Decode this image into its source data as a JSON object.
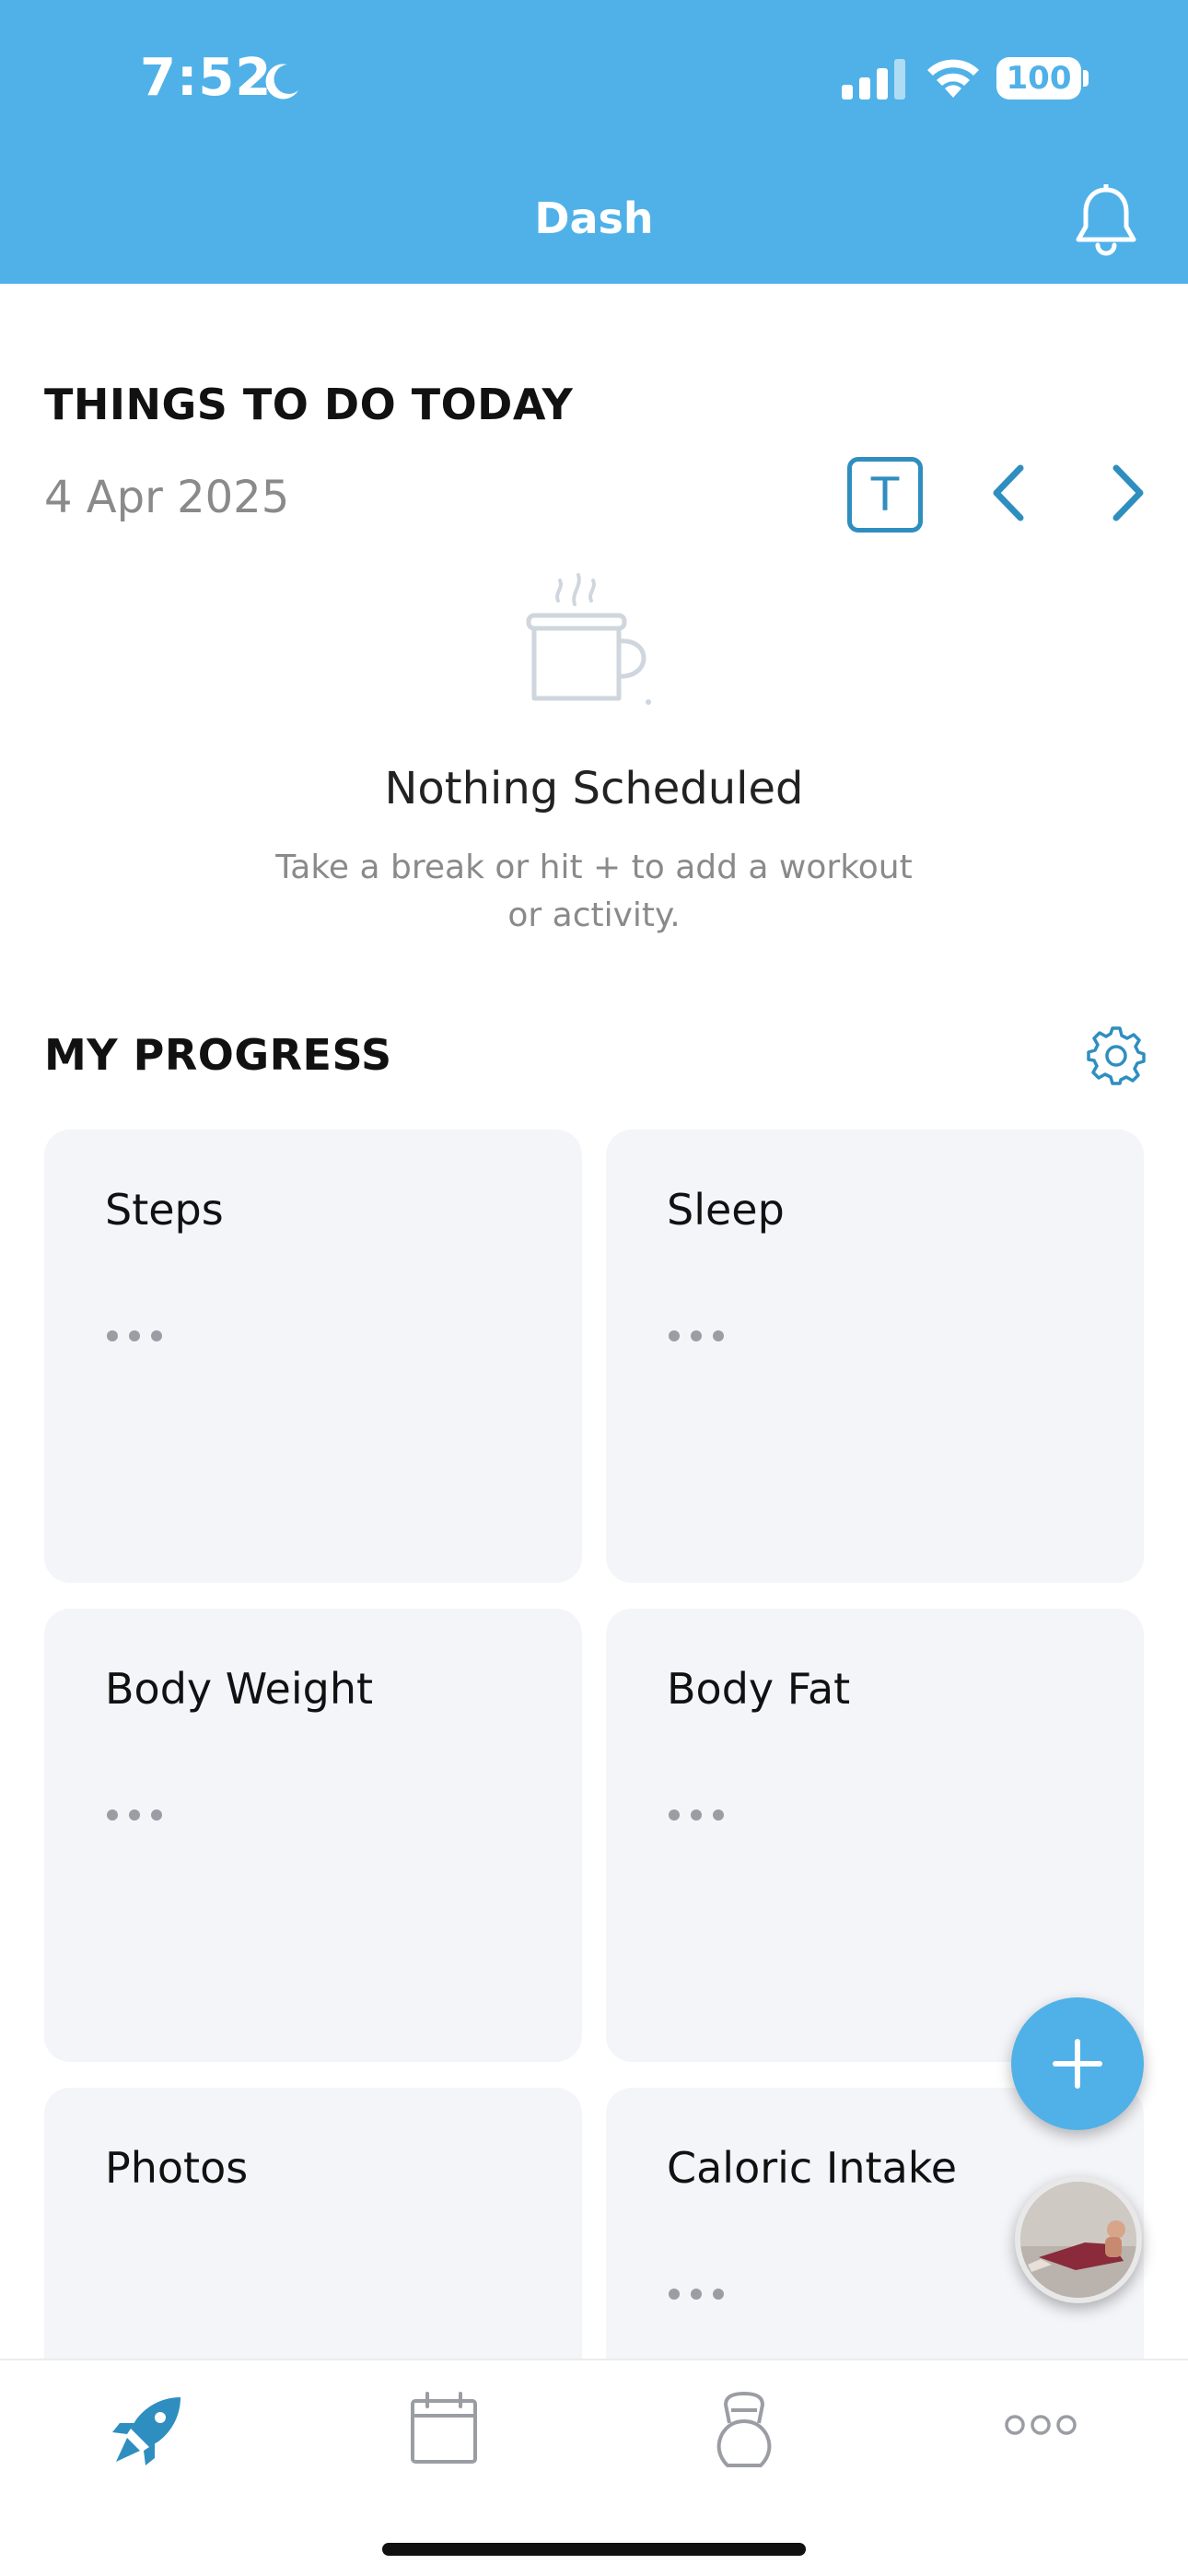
{
  "status_bar": {
    "time": "7:52",
    "battery": "100"
  },
  "header": {
    "title": "Dash"
  },
  "todo": {
    "section_title": "THINGS TO DO TODAY",
    "date": "4 Apr 2025",
    "today_button": "T",
    "empty_title": "Nothing Scheduled",
    "empty_subtitle": "Take a break or hit + to add a workout or activity."
  },
  "progress": {
    "section_title": "MY PROGRESS",
    "cards": [
      {
        "label": "Steps",
        "loading": true
      },
      {
        "label": "Sleep",
        "loading": true
      },
      {
        "label": "Body Weight",
        "loading": true
      },
      {
        "label": "Body Fat",
        "loading": true
      },
      {
        "label": "Photos",
        "loading": false
      },
      {
        "label": "Caloric Intake",
        "loading": true
      }
    ]
  },
  "tabs": [
    {
      "icon": "rocket-icon",
      "active": true
    },
    {
      "icon": "calendar-icon",
      "active": false
    },
    {
      "icon": "kettlebell-icon",
      "active": false
    },
    {
      "icon": "more-icon",
      "active": false
    }
  ],
  "colors": {
    "header": "#4fb1e8",
    "accent": "#2f8ec0",
    "card_bg": "#f4f5f9",
    "muted_text": "#8a8a8a"
  }
}
